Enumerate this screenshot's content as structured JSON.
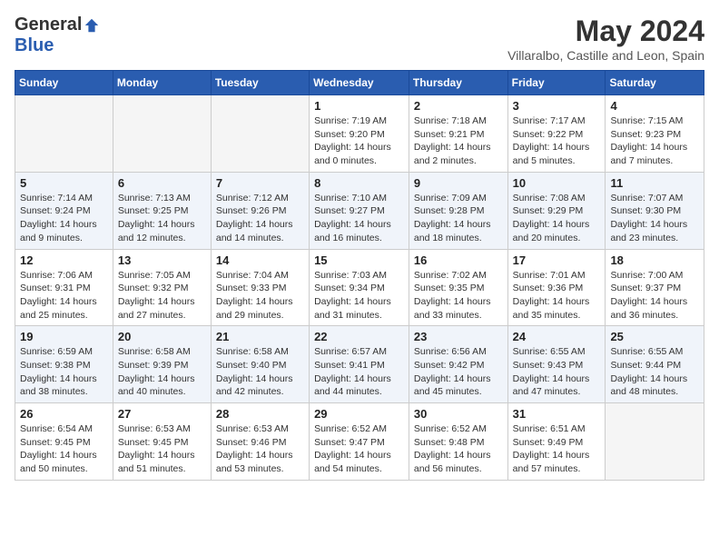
{
  "header": {
    "logo_general": "General",
    "logo_blue": "Blue",
    "month_title": "May 2024",
    "subtitle": "Villaralbo, Castille and Leon, Spain"
  },
  "weekdays": [
    "Sunday",
    "Monday",
    "Tuesday",
    "Wednesday",
    "Thursday",
    "Friday",
    "Saturday"
  ],
  "weeks": [
    [
      {
        "day": "",
        "sunrise": "",
        "sunset": "",
        "daylight": ""
      },
      {
        "day": "",
        "sunrise": "",
        "sunset": "",
        "daylight": ""
      },
      {
        "day": "",
        "sunrise": "",
        "sunset": "",
        "daylight": ""
      },
      {
        "day": "1",
        "sunrise": "Sunrise: 7:19 AM",
        "sunset": "Sunset: 9:20 PM",
        "daylight": "Daylight: 14 hours and 0 minutes."
      },
      {
        "day": "2",
        "sunrise": "Sunrise: 7:18 AM",
        "sunset": "Sunset: 9:21 PM",
        "daylight": "Daylight: 14 hours and 2 minutes."
      },
      {
        "day": "3",
        "sunrise": "Sunrise: 7:17 AM",
        "sunset": "Sunset: 9:22 PM",
        "daylight": "Daylight: 14 hours and 5 minutes."
      },
      {
        "day": "4",
        "sunrise": "Sunrise: 7:15 AM",
        "sunset": "Sunset: 9:23 PM",
        "daylight": "Daylight: 14 hours and 7 minutes."
      }
    ],
    [
      {
        "day": "5",
        "sunrise": "Sunrise: 7:14 AM",
        "sunset": "Sunset: 9:24 PM",
        "daylight": "Daylight: 14 hours and 9 minutes."
      },
      {
        "day": "6",
        "sunrise": "Sunrise: 7:13 AM",
        "sunset": "Sunset: 9:25 PM",
        "daylight": "Daylight: 14 hours and 12 minutes."
      },
      {
        "day": "7",
        "sunrise": "Sunrise: 7:12 AM",
        "sunset": "Sunset: 9:26 PM",
        "daylight": "Daylight: 14 hours and 14 minutes."
      },
      {
        "day": "8",
        "sunrise": "Sunrise: 7:10 AM",
        "sunset": "Sunset: 9:27 PM",
        "daylight": "Daylight: 14 hours and 16 minutes."
      },
      {
        "day": "9",
        "sunrise": "Sunrise: 7:09 AM",
        "sunset": "Sunset: 9:28 PM",
        "daylight": "Daylight: 14 hours and 18 minutes."
      },
      {
        "day": "10",
        "sunrise": "Sunrise: 7:08 AM",
        "sunset": "Sunset: 9:29 PM",
        "daylight": "Daylight: 14 hours and 20 minutes."
      },
      {
        "day": "11",
        "sunrise": "Sunrise: 7:07 AM",
        "sunset": "Sunset: 9:30 PM",
        "daylight": "Daylight: 14 hours and 23 minutes."
      }
    ],
    [
      {
        "day": "12",
        "sunrise": "Sunrise: 7:06 AM",
        "sunset": "Sunset: 9:31 PM",
        "daylight": "Daylight: 14 hours and 25 minutes."
      },
      {
        "day": "13",
        "sunrise": "Sunrise: 7:05 AM",
        "sunset": "Sunset: 9:32 PM",
        "daylight": "Daylight: 14 hours and 27 minutes."
      },
      {
        "day": "14",
        "sunrise": "Sunrise: 7:04 AM",
        "sunset": "Sunset: 9:33 PM",
        "daylight": "Daylight: 14 hours and 29 minutes."
      },
      {
        "day": "15",
        "sunrise": "Sunrise: 7:03 AM",
        "sunset": "Sunset: 9:34 PM",
        "daylight": "Daylight: 14 hours and 31 minutes."
      },
      {
        "day": "16",
        "sunrise": "Sunrise: 7:02 AM",
        "sunset": "Sunset: 9:35 PM",
        "daylight": "Daylight: 14 hours and 33 minutes."
      },
      {
        "day": "17",
        "sunrise": "Sunrise: 7:01 AM",
        "sunset": "Sunset: 9:36 PM",
        "daylight": "Daylight: 14 hours and 35 minutes."
      },
      {
        "day": "18",
        "sunrise": "Sunrise: 7:00 AM",
        "sunset": "Sunset: 9:37 PM",
        "daylight": "Daylight: 14 hours and 36 minutes."
      }
    ],
    [
      {
        "day": "19",
        "sunrise": "Sunrise: 6:59 AM",
        "sunset": "Sunset: 9:38 PM",
        "daylight": "Daylight: 14 hours and 38 minutes."
      },
      {
        "day": "20",
        "sunrise": "Sunrise: 6:58 AM",
        "sunset": "Sunset: 9:39 PM",
        "daylight": "Daylight: 14 hours and 40 minutes."
      },
      {
        "day": "21",
        "sunrise": "Sunrise: 6:58 AM",
        "sunset": "Sunset: 9:40 PM",
        "daylight": "Daylight: 14 hours and 42 minutes."
      },
      {
        "day": "22",
        "sunrise": "Sunrise: 6:57 AM",
        "sunset": "Sunset: 9:41 PM",
        "daylight": "Daylight: 14 hours and 44 minutes."
      },
      {
        "day": "23",
        "sunrise": "Sunrise: 6:56 AM",
        "sunset": "Sunset: 9:42 PM",
        "daylight": "Daylight: 14 hours and 45 minutes."
      },
      {
        "day": "24",
        "sunrise": "Sunrise: 6:55 AM",
        "sunset": "Sunset: 9:43 PM",
        "daylight": "Daylight: 14 hours and 47 minutes."
      },
      {
        "day": "25",
        "sunrise": "Sunrise: 6:55 AM",
        "sunset": "Sunset: 9:44 PM",
        "daylight": "Daylight: 14 hours and 48 minutes."
      }
    ],
    [
      {
        "day": "26",
        "sunrise": "Sunrise: 6:54 AM",
        "sunset": "Sunset: 9:45 PM",
        "daylight": "Daylight: 14 hours and 50 minutes."
      },
      {
        "day": "27",
        "sunrise": "Sunrise: 6:53 AM",
        "sunset": "Sunset: 9:45 PM",
        "daylight": "Daylight: 14 hours and 51 minutes."
      },
      {
        "day": "28",
        "sunrise": "Sunrise: 6:53 AM",
        "sunset": "Sunset: 9:46 PM",
        "daylight": "Daylight: 14 hours and 53 minutes."
      },
      {
        "day": "29",
        "sunrise": "Sunrise: 6:52 AM",
        "sunset": "Sunset: 9:47 PM",
        "daylight": "Daylight: 14 hours and 54 minutes."
      },
      {
        "day": "30",
        "sunrise": "Sunrise: 6:52 AM",
        "sunset": "Sunset: 9:48 PM",
        "daylight": "Daylight: 14 hours and 56 minutes."
      },
      {
        "day": "31",
        "sunrise": "Sunrise: 6:51 AM",
        "sunset": "Sunset: 9:49 PM",
        "daylight": "Daylight: 14 hours and 57 minutes."
      },
      {
        "day": "",
        "sunrise": "",
        "sunset": "",
        "daylight": ""
      }
    ]
  ]
}
